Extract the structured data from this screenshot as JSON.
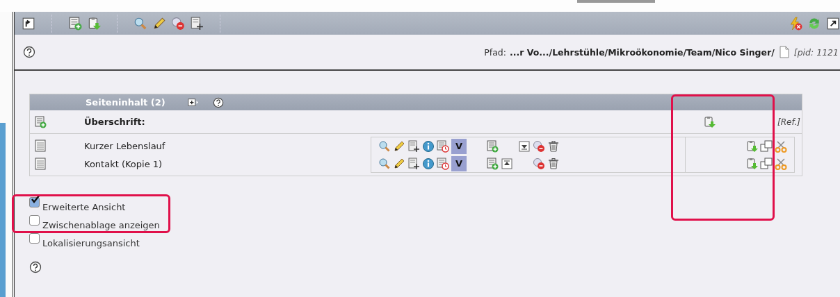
{
  "toolbar": {
    "left": [
      {
        "kind": "up"
      },
      {
        "kind": "sep"
      },
      {
        "kind": "new"
      },
      {
        "kind": "paste"
      },
      {
        "kind": "sep"
      },
      {
        "kind": "view"
      },
      {
        "kind": "edit"
      },
      {
        "kind": "hide"
      },
      {
        "kind": "move"
      },
      {
        "kind": "sep"
      }
    ],
    "right": [
      {
        "kind": "flash"
      },
      {
        "kind": "refresh"
      },
      {
        "kind": "open"
      }
    ]
  },
  "path_bar": {
    "label": "Pfad:",
    "path": "...r Vo.../Lehrstühle/Mikroökonomie/Team/Nico Singer/",
    "pid": "[pid: 1121"
  },
  "content": {
    "title": "Seiteninhalt (2)",
    "heading": "Überschrift:",
    "ref": "[Ref.]",
    "rows": [
      {
        "title": "Kurzer Lebenslauf",
        "actions": [
          {
            "kind": "view"
          },
          {
            "kind": "edit"
          },
          {
            "kind": "move"
          },
          {
            "kind": "info"
          },
          {
            "kind": "history"
          },
          {
            "kind": "version",
            "label": "V"
          },
          {
            "kind": "gap"
          },
          {
            "kind": "new"
          },
          {
            "kind": "gap"
          },
          {
            "kind": "down"
          },
          {
            "kind": "hide"
          },
          {
            "kind": "trash"
          }
        ],
        "clip": [
          {
            "kind": "paste"
          },
          {
            "kind": "copy"
          },
          {
            "kind": "cut"
          }
        ]
      },
      {
        "title": "Kontakt (Kopie 1)",
        "actions": [
          {
            "kind": "view"
          },
          {
            "kind": "edit"
          },
          {
            "kind": "move"
          },
          {
            "kind": "info"
          },
          {
            "kind": "history"
          },
          {
            "kind": "version",
            "label": "V"
          },
          {
            "kind": "gap"
          },
          {
            "kind": "new"
          },
          {
            "kind": "up2"
          },
          {
            "kind": "gap"
          },
          {
            "kind": "hide"
          },
          {
            "kind": "trash"
          }
        ],
        "clip": [
          {
            "kind": "paste"
          },
          {
            "kind": "copy"
          },
          {
            "kind": "cut"
          }
        ]
      }
    ]
  },
  "options": [
    {
      "label": "Erweiterte Ansicht",
      "checked": true
    },
    {
      "label": "Zwischenablage anzeigen",
      "checked": false
    },
    {
      "label": "Lokalisierungsansicht",
      "checked": false
    }
  ]
}
